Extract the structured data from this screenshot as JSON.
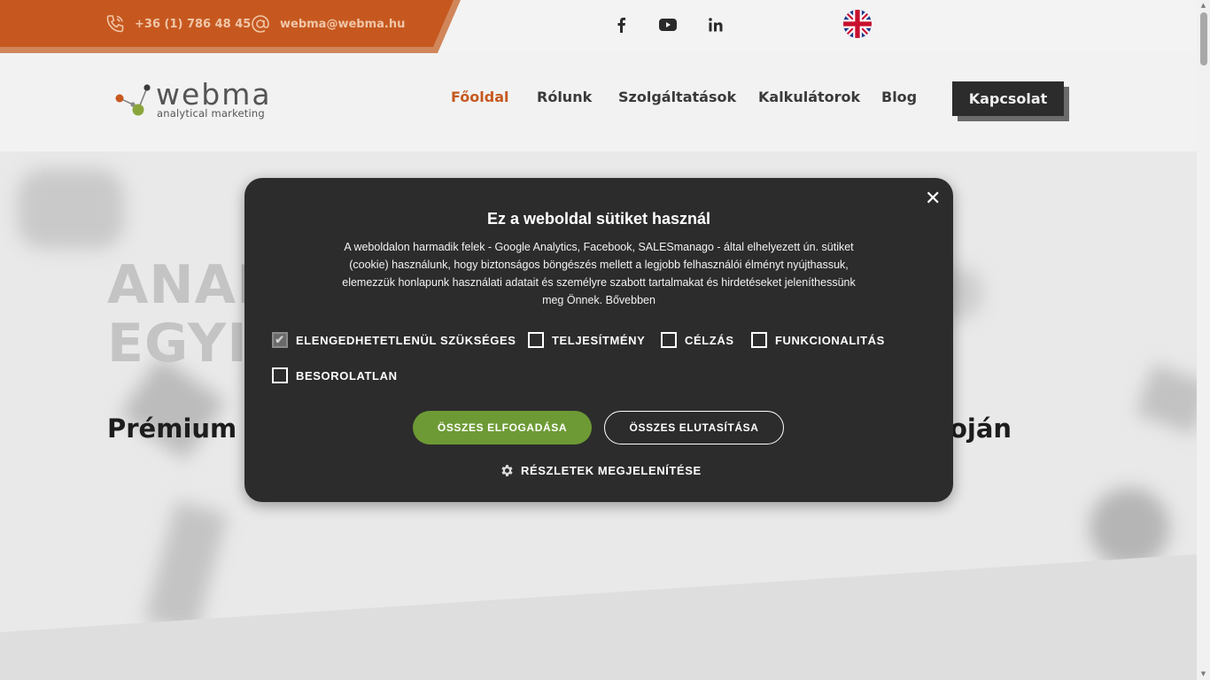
{
  "topbar": {
    "phone": "+36 (1) 786 48 45",
    "email": "webma@webma.hu",
    "social_icons": [
      "facebook-icon",
      "youtube-icon",
      "linkedin-icon"
    ],
    "language_flag": "uk-flag-icon"
  },
  "header": {
    "logo_word": "webma",
    "logo_sub": "analytical marketing",
    "nav": [
      {
        "label": "Főoldal",
        "active": true
      },
      {
        "label": "Rólunk",
        "active": false
      },
      {
        "label": "Szolgáltatások",
        "active": false
      },
      {
        "label": "Kalkulátorok",
        "active": false
      },
      {
        "label": "Blog",
        "active": false
      }
    ],
    "contact_button": "Kapcsolat"
  },
  "hero": {
    "title_line1": "ANAL",
    "title_line2": "EGYIK",
    "subtitle_left": "Prémium d",
    "subtitle_right": "oján"
  },
  "cookie_dialog": {
    "title": "Ez a weboldal sütiket használ",
    "text": "A weboldalon harmadik felek - Google Analytics, Facebook, SALESmanago - által elhelyezett ún. sütiket (cookie) használunk, hogy biztonságos böngészés mellett a legjobb felhasználói élményt nyújthassuk, elemezzük honlapunk használati adatait és személyre szabott tartalmakat és hirdetéseket jeleníthessünk meg Önnek. Bővebben",
    "checkboxes": [
      {
        "label": "ELENGEDHETETLENÜL SZÜKSÉGES",
        "checked": true
      },
      {
        "label": "TELJESÍTMÉNY",
        "checked": false
      },
      {
        "label": "CÉLZÁS",
        "checked": false
      },
      {
        "label": "FUNKCIONALITÁS",
        "checked": false
      },
      {
        "label": "BESOROLATLAN",
        "checked": false
      }
    ],
    "accept_all": "ÖSSZES ELFOGADÁSA",
    "reject_all": "ÖSSZES ELUTASÍTÁSA",
    "details": "RÉSZLETEK MEGJELENÍTÉSE",
    "close_icon": "close-icon"
  },
  "colors": {
    "brand_orange": "#c6581f",
    "accept_green": "#6d9a35",
    "dialog_bg": "#2c2c2c"
  }
}
